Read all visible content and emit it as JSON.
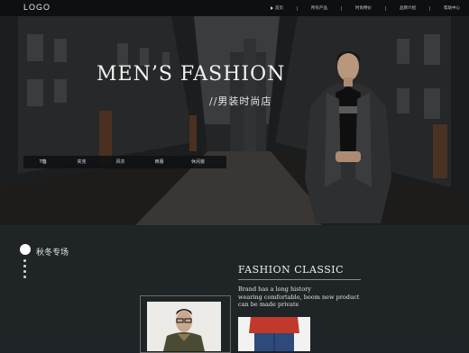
{
  "header": {
    "logo": "LOGO",
    "nav": [
      "首页",
      "所有产品",
      "时尚特价",
      "品牌介绍",
      "帮助中心"
    ]
  },
  "hero": {
    "title": "MEN’S FASHION",
    "subtitle": "//男装时尚店",
    "categories": [
      "T恤",
      "夹克",
      "风衣",
      "西服",
      "休闲装"
    ]
  },
  "section": {
    "title": "秋冬专场",
    "feature_title": "FASHION CLASSIC",
    "feature_lines": [
      "Brand has a long history",
      "wearing comfortable, boom new product",
      "can be made private"
    ]
  },
  "colors": {
    "background": "#1d2226",
    "header": "#0d0f10",
    "accent": "#ffffff"
  }
}
